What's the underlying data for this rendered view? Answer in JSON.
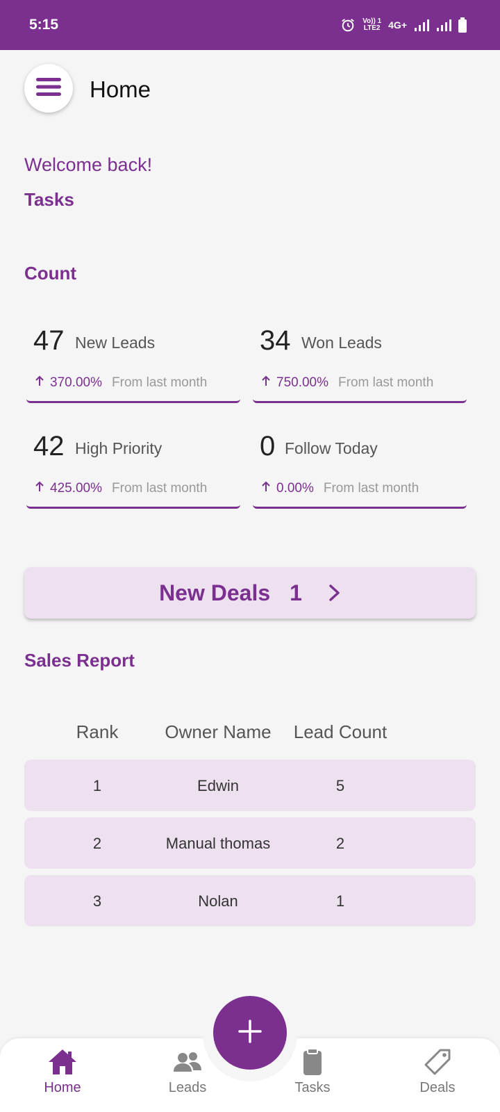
{
  "status_bar": {
    "time": "5:15",
    "network_top": "Vo)) 1",
    "network_bottom": "LTE2",
    "network_type": "4G+"
  },
  "header": {
    "title": "Home",
    "menu_icon": "hamburger-menu-icon"
  },
  "welcome": "Welcome back!",
  "sections": {
    "tasks": "Tasks",
    "count": "Count",
    "sales_report": "Sales Report"
  },
  "stats": [
    {
      "value": "47",
      "label": "New Leads",
      "percent": "370.00%",
      "from": "From last month"
    },
    {
      "value": "34",
      "label": "Won Leads",
      "percent": "750.00%",
      "from": "From last month"
    },
    {
      "value": "42",
      "label": "High Priority",
      "percent": "425.00%",
      "from": "From last month"
    },
    {
      "value": "0",
      "label": "Follow Today",
      "percent": "0.00%",
      "from": "From last month"
    }
  ],
  "new_deals": {
    "label": "New Deals",
    "count": "1"
  },
  "sales_table": {
    "headers": {
      "rank": "Rank",
      "owner": "Owner Name",
      "count": "Lead Count"
    },
    "rows": [
      {
        "rank": "1",
        "owner": "Edwin",
        "count": "5"
      },
      {
        "rank": "2",
        "owner": "Manual thomas",
        "count": "2"
      },
      {
        "rank": "3",
        "owner": "Nolan",
        "count": "1"
      }
    ]
  },
  "bottom_nav": [
    {
      "label": "Home",
      "icon": "home-icon",
      "active": true
    },
    {
      "label": "Leads",
      "icon": "people-icon",
      "active": false
    },
    {
      "label": "Tasks",
      "icon": "clipboard-icon",
      "active": false
    },
    {
      "label": "Deals",
      "icon": "tag-icon",
      "active": false
    }
  ],
  "colors": {
    "primary": "#7b2f8f",
    "card_bg": "#ede1f0",
    "background": "#f5f5f5"
  }
}
